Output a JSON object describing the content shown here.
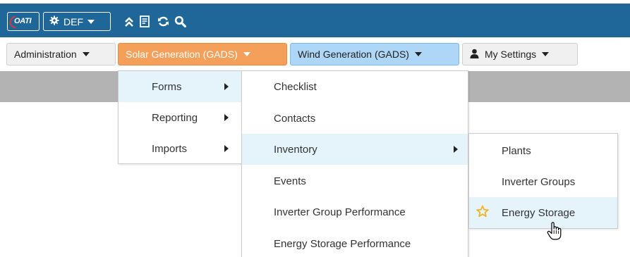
{
  "toolbar": {
    "logo_text": "OATI",
    "def_label": "DEF",
    "icons": [
      "gear-icon",
      "collapse-chevrons-icon",
      "notes-icon",
      "refresh-icon",
      "search-icon"
    ]
  },
  "menubar": {
    "items": [
      {
        "label": "Administration"
      },
      {
        "label": "Solar Generation (GADS)"
      },
      {
        "label": "Wind Generation (GADS)"
      },
      {
        "label": "My Settings"
      }
    ]
  },
  "menu_level1": {
    "items": [
      {
        "label": "Forms",
        "active": true,
        "has_submenu": true
      },
      {
        "label": "Reporting",
        "active": false,
        "has_submenu": true
      },
      {
        "label": "Imports",
        "active": false,
        "has_submenu": true
      }
    ]
  },
  "menu_level2": {
    "items": [
      {
        "label": "Checklist"
      },
      {
        "label": "Contacts"
      },
      {
        "label": "Inventory",
        "active": true,
        "has_submenu": true
      },
      {
        "label": "Events"
      },
      {
        "label": "Inverter Group Performance"
      },
      {
        "label": "Energy Storage Performance"
      }
    ]
  },
  "menu_level3": {
    "items": [
      {
        "label": "Plants"
      },
      {
        "label": "Inverter Groups"
      },
      {
        "label": "Energy Storage",
        "active": true,
        "favorite_icon": "star-icon"
      }
    ]
  },
  "colors": {
    "header_blue": "#1f6699",
    "solar_orange": "#f5a05a",
    "wind_blue": "#aed6f7",
    "highlight": "#e5f3fb",
    "star": "#f0b429"
  }
}
